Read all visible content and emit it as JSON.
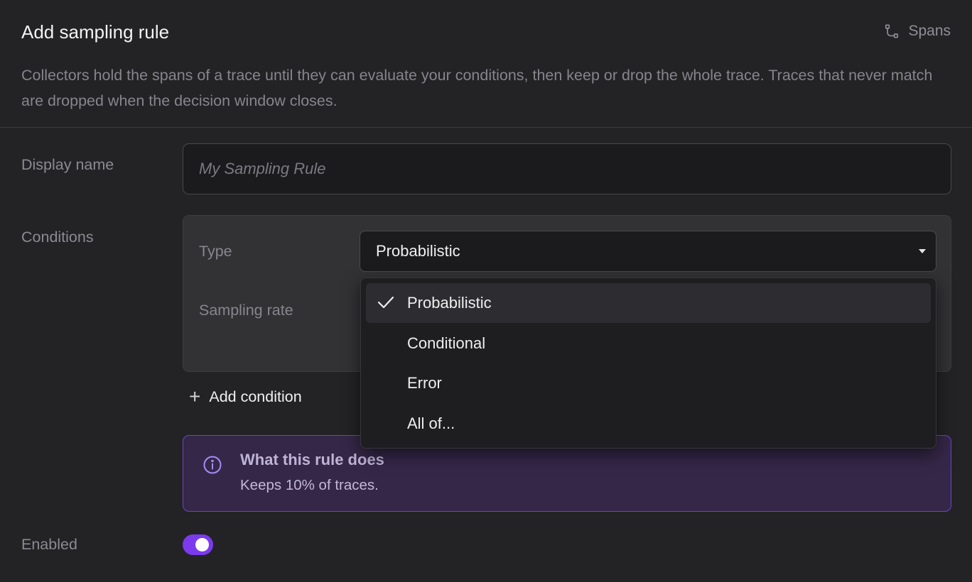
{
  "header": {
    "title": "Add sampling rule",
    "spans_label": "Spans",
    "description": "Collectors hold the spans of a trace until they can evaluate your conditions, then keep or drop the whole trace. Traces that never match are dropped when the decision window closes."
  },
  "display_name": {
    "label": "Display name",
    "placeholder": "My Sampling Rule",
    "value": ""
  },
  "conditions": {
    "label": "Conditions",
    "type_label": "Type",
    "type_value": "Probabilistic",
    "sampling_rate_label": "Sampling rate",
    "add_condition_label": "Add condition"
  },
  "type_menu": {
    "items": [
      {
        "label": "Probabilistic",
        "selected": true
      },
      {
        "label": "Conditional",
        "selected": false
      },
      {
        "label": "Error",
        "selected": false
      },
      {
        "label": "All of...",
        "selected": false
      }
    ]
  },
  "info": {
    "title": "What this rule does",
    "text": "Keeps 10% of traces."
  },
  "enabled": {
    "label": "Enabled",
    "on": true
  },
  "colors": {
    "accent": "#7c3aed",
    "info_background": "#352748",
    "info_border": "#6d43c8"
  },
  "icons": {
    "spans": "route-icon",
    "info": "info-circle-icon",
    "add": "plus-icon",
    "check": "check-icon",
    "caret": "caret-down-icon"
  }
}
